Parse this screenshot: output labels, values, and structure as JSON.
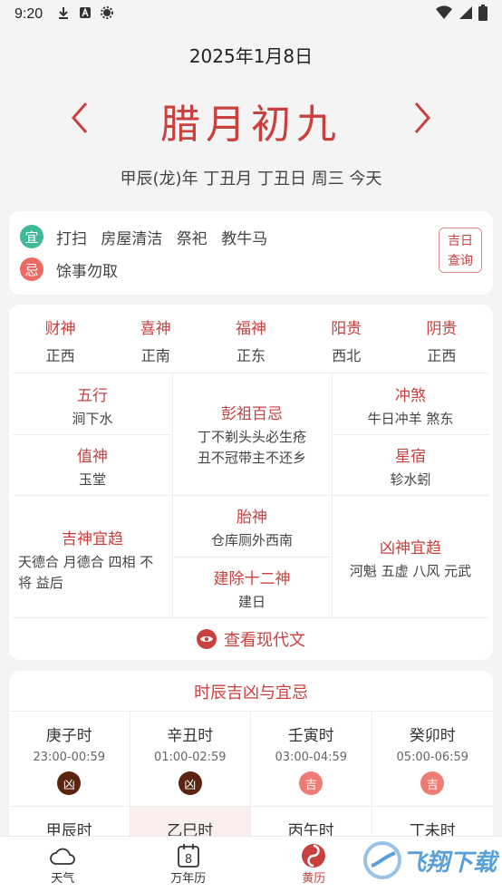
{
  "status": {
    "time": "9:20"
  },
  "header": {
    "date": "2025年1月8日",
    "lunar": "腊月初九",
    "ganzhi": "甲辰(龙)年  丁丑月  丁丑日  周三  今天",
    "prev": "‹",
    "next": "›"
  },
  "yiji": {
    "yi_badge": "宜",
    "yi_items": "打扫 房屋清洁 祭祀 教牛马",
    "ji_badge": "忌",
    "ji_items": "馀事勿取",
    "jiri_line1": "吉日",
    "jiri_line2": "查询"
  },
  "gods": {
    "top": [
      {
        "label": "财神",
        "value": "正西"
      },
      {
        "label": "喜神",
        "value": "正南"
      },
      {
        "label": "福神",
        "value": "正东"
      },
      {
        "label": "阳贵",
        "value": "西北"
      },
      {
        "label": "阴贵",
        "value": "正西"
      }
    ],
    "wuxing": {
      "label": "五行",
      "value": "涧下水"
    },
    "zhishen": {
      "label": "值神",
      "value": "玉堂"
    },
    "pengzu": {
      "label": "彭祖百忌",
      "line1": "丁不剃头头必生疮",
      "line2": "丑不冠带主不还乡"
    },
    "chongsha": {
      "label": "冲煞",
      "value": "牛日冲羊 煞东"
    },
    "xingxiu": {
      "label": "星宿",
      "value": "轸水蚓"
    },
    "jishen": {
      "label": "吉神宜趋",
      "line1": "天德合 月德合 四相 不",
      "line2": "将 益后"
    },
    "taishen": {
      "label": "胎神",
      "value": "仓库厕外西南"
    },
    "jianchu": {
      "label": "建除十二神",
      "value": "建日"
    },
    "xiongshen": {
      "label": "凶神宜趋",
      "value": "河魁 五虚 八风 元武"
    },
    "modern_link": "查看现代文"
  },
  "hours": {
    "title": "时辰吉凶与宜忌",
    "cells": [
      {
        "name": "庚子时",
        "range": "23:00-00:59",
        "fate": "凶"
      },
      {
        "name": "辛丑时",
        "range": "01:00-02:59",
        "fate": "凶"
      },
      {
        "name": "壬寅时",
        "range": "03:00-04:59",
        "fate": "吉"
      },
      {
        "name": "癸卯时",
        "range": "05:00-06:59",
        "fate": "吉"
      },
      {
        "name": "甲辰时",
        "range": "",
        "fate": ""
      },
      {
        "name": "乙巳时",
        "range": "",
        "fate": ""
      },
      {
        "name": "丙午时",
        "range": "",
        "fate": ""
      },
      {
        "name": "丁未时",
        "range": "",
        "fate": ""
      }
    ]
  },
  "tabs": [
    {
      "label": "天气",
      "icon": "cloud-icon"
    },
    {
      "label": "万年历",
      "icon": "calendar-icon",
      "day": "8"
    },
    {
      "label": "黄历",
      "icon": "almanac-icon"
    },
    {
      "label": "",
      "icon": "hidden-tab"
    }
  ],
  "watermark": "飞翔下载",
  "colors": {
    "accent": "#c9413e",
    "yi": "#3fb99a",
    "ji": "#ec6a63",
    "bad": "#5a2410",
    "good": "#ef7b75"
  }
}
